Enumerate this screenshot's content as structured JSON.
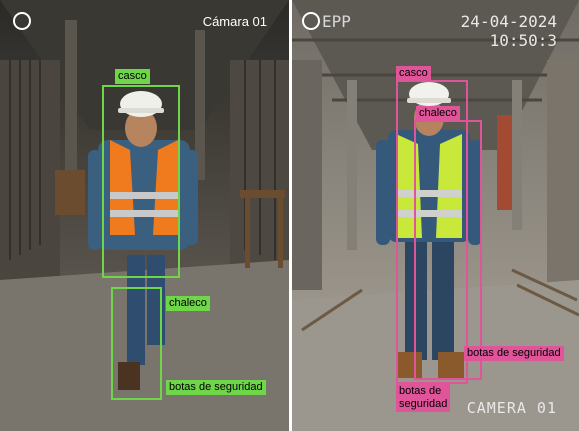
{
  "left_panel": {
    "camera_label": "Cámara 01",
    "detections": [
      {
        "label": "casco"
      },
      {
        "label": "chaleco"
      },
      {
        "label": "botas de seguridad"
      }
    ]
  },
  "right_panel": {
    "overlay_title": "EPP",
    "date": "24-04-2024",
    "time": "10:50:3",
    "camera_label": "CAMERA 01",
    "detections": [
      {
        "label": "casco"
      },
      {
        "label": "chaleco"
      },
      {
        "label": "botas de seguridad"
      },
      {
        "label": "botas de\nseguridad"
      }
    ]
  },
  "colors": {
    "left_box": "#6fd64a",
    "right_box": "#e0559a",
    "vest_left": "#f07a1e",
    "vest_right": "#c8e83a"
  },
  "icons": {
    "record_indicator": "circle-icon"
  }
}
